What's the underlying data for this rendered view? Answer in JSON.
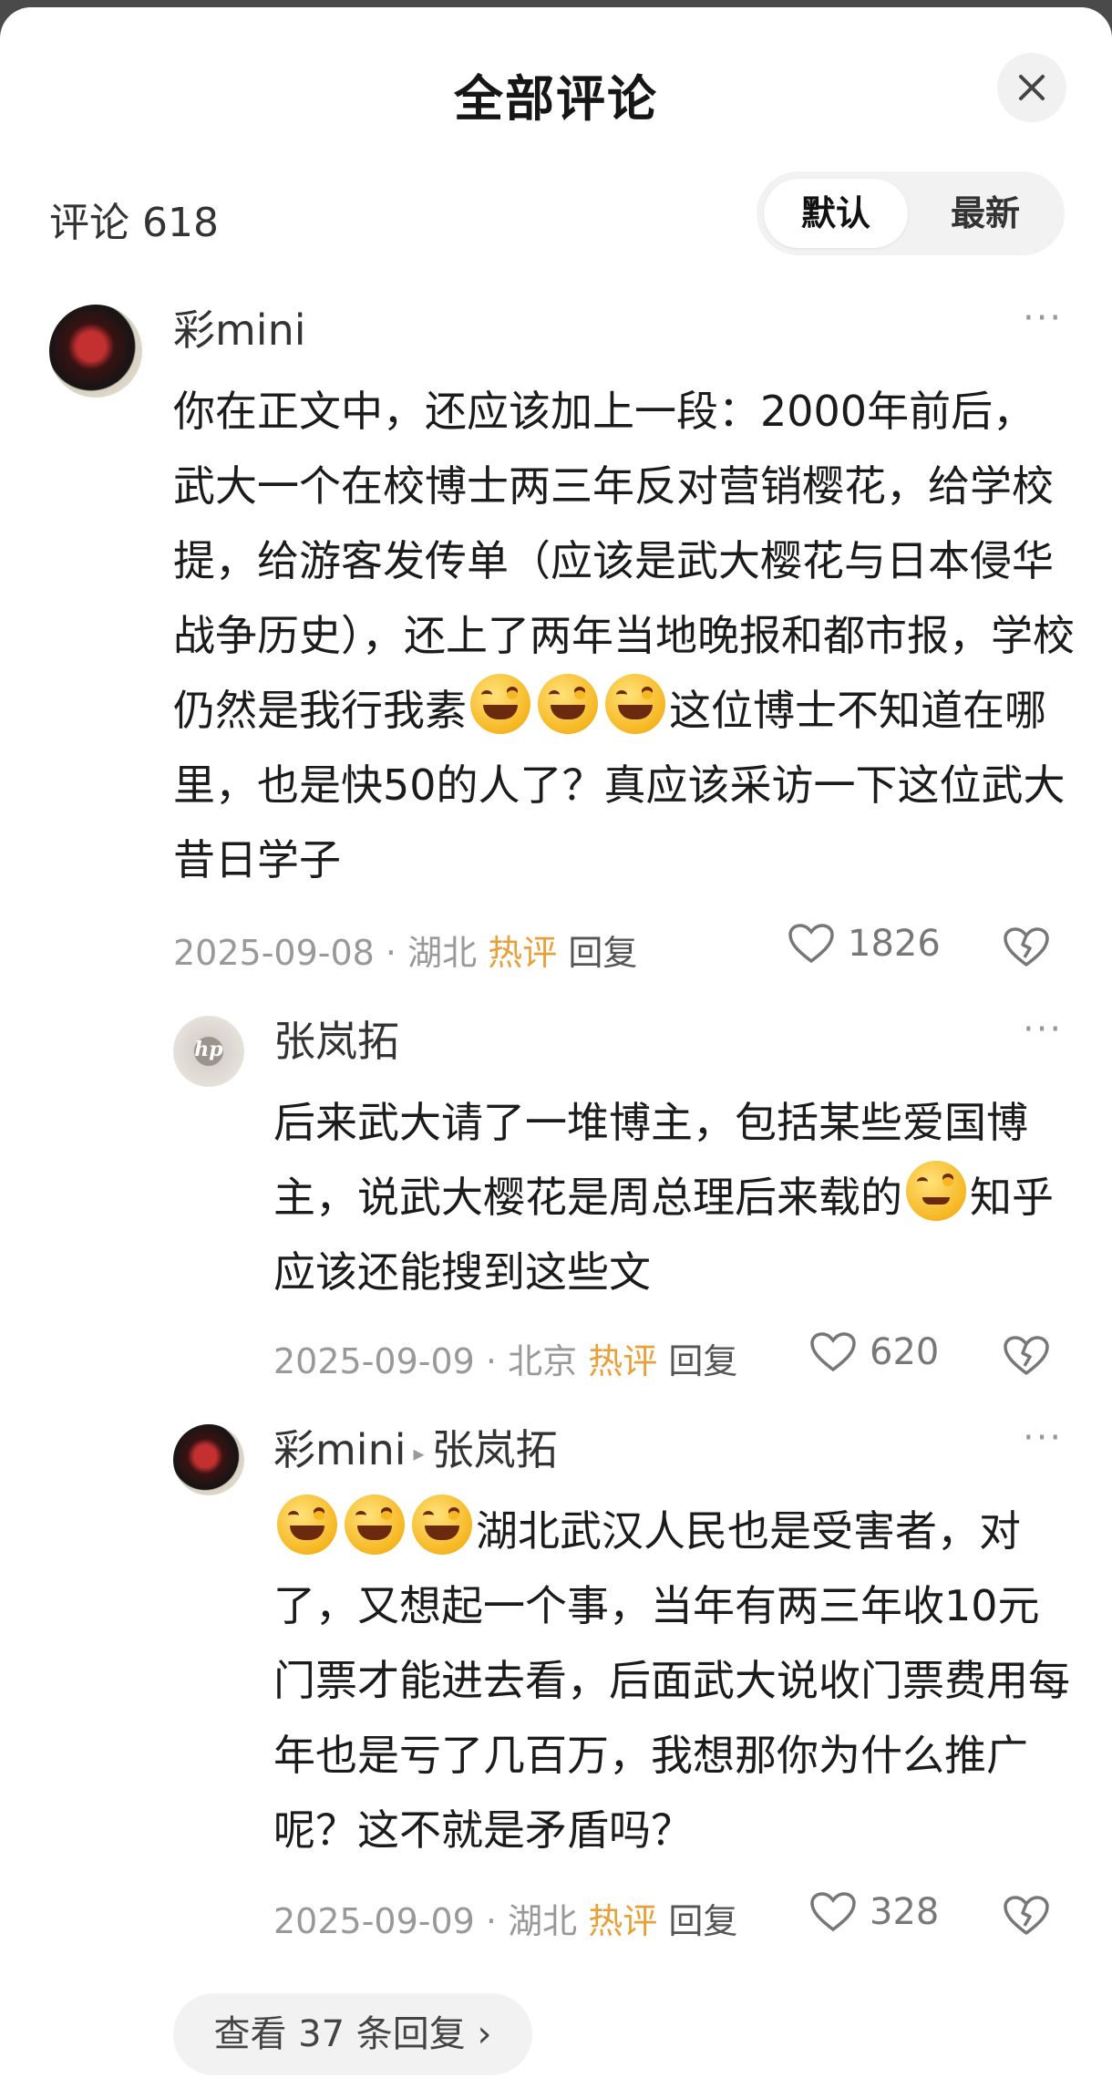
{
  "header": {
    "title": "全部评论"
  },
  "comment_count": {
    "label": "评论",
    "value": "618"
  },
  "sort": {
    "default_label": "默认",
    "latest_label": "最新"
  },
  "comments": [
    {
      "user": "彩mini",
      "text_parts": [
        "你在正文中，还应该加上一段：2000年前后，武大一个在校博士两三年反对营销樱花，给学校提，给游客发传单（应该是武大樱花与日本侵华战争历史），还上了两年当地晚报和都市报，学校仍然是我行我素",
        "这位博士不知道在哪里，也是快50的人了？真应该采访一下这位武大昔日学子"
      ],
      "date": "2025-09-08",
      "location": "湖北",
      "hot": "热评",
      "reply": "回复",
      "likes": "1826"
    },
    {
      "user": "张岚拓",
      "text_parts": [
        "后来武大请了一堆博主，包括某些爱国博主，说武大樱花是周总理后来载的",
        "知乎应该还能搜到这些文"
      ],
      "date": "2025-09-09",
      "location": "北京",
      "hot": "热评",
      "reply": "回复",
      "likes": "620"
    },
    {
      "user": "彩mini",
      "reply_to": "张岚拓",
      "text_parts": [
        "",
        "湖北武汉人民也是受害者，对了，又想起一个事，当年有两三年收10元门票才能进去看，后面武大说收门票费用每年也是亏了几百万，我想那你为什么推广呢？这不就是矛盾吗？"
      ],
      "date": "2025-09-09",
      "location": "湖北",
      "hot": "热评",
      "reply": "回复",
      "likes": "328"
    }
  ],
  "view_more": {
    "label": "查看 37 条回复",
    "chevron": "›"
  },
  "icons": {
    "close": "close-icon",
    "more": "more-icon",
    "like": "heart-icon",
    "dislike": "broken-heart-icon",
    "emoji_laugh": "rofl-emoji-icon",
    "emoji_smirk": "smirk-emoji-icon"
  },
  "colors": {
    "hot": "#e8a13a",
    "meta": "#999999",
    "background": "#ffffff"
  }
}
